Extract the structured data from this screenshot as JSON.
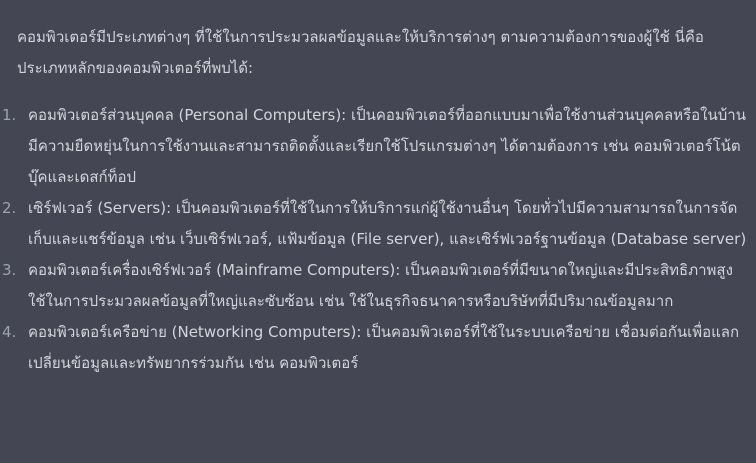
{
  "message": {
    "intro": "คอมพิวเตอร์มีประเภทต่างๆ ที่ใช้ในการประมวลผลข้อมูลและให้บริการต่างๆ ตามความต้องการของผู้ใช้ นี่คือประเภทหลักของคอมพิวเตอร์ที่พบได้:",
    "items": [
      {
        "number": "1.",
        "text": "คอมพิวเตอร์ส่วนบุคคล (Personal Computers): เป็นคอมพิวเตอร์ที่ออกแบบมาเพื่อใช้งานส่วนบุคคลหรือในบ้าน มีความยืดหยุ่นในการใช้งานและสามารถติดตั้งและเรียกใช้โปรแกรมต่างๆ ได้ตามต้องการ เช่น คอมพิวเตอร์โน้ตบุ๊คและเดสก์ท็อป"
      },
      {
        "number": "2.",
        "text": "เซิร์ฟเวอร์ (Servers): เป็นคอมพิวเตอร์ที่ใช้ในการให้บริการแก่ผู้ใช้งานอื่นๆ โดยทั่วไปมีความสามารถในการจัดเก็บและแชร์ข้อมูล เช่น เว็บเซิร์ฟเวอร์, แฟ้มข้อมูล (File server), และเซิร์ฟเวอร์ฐานข้อมูล (Database server)"
      },
      {
        "number": "3.",
        "text": "คอมพิวเตอร์เครื่องเซิร์ฟเวอร์ (Mainframe Computers): เป็นคอมพิวเตอร์ที่มีขนาดใหญ่และมีประสิทธิภาพสูง ใช้ในการประมวลผลข้อมูลที่ใหญ่และซับซ้อน เช่น ใช้ในธุรกิจธนาคารหรือบริษัทที่มีปริมาณข้อมูลมาก"
      },
      {
        "number": "4.",
        "text": "คอมพิวเตอร์เครือข่าย (Networking Computers): เป็นคอมพิวเตอร์ที่ใช้ในระบบเครือข่าย เชื่อมต่อกันเพื่อแลกเปลี่ยนข้อมูลและทรัพยากรร่วมกัน เช่น คอมพิวเตอร์"
      }
    ]
  },
  "colors": {
    "background": "#444654",
    "text": "#d1d5db",
    "list_number": "#9ca3af"
  }
}
